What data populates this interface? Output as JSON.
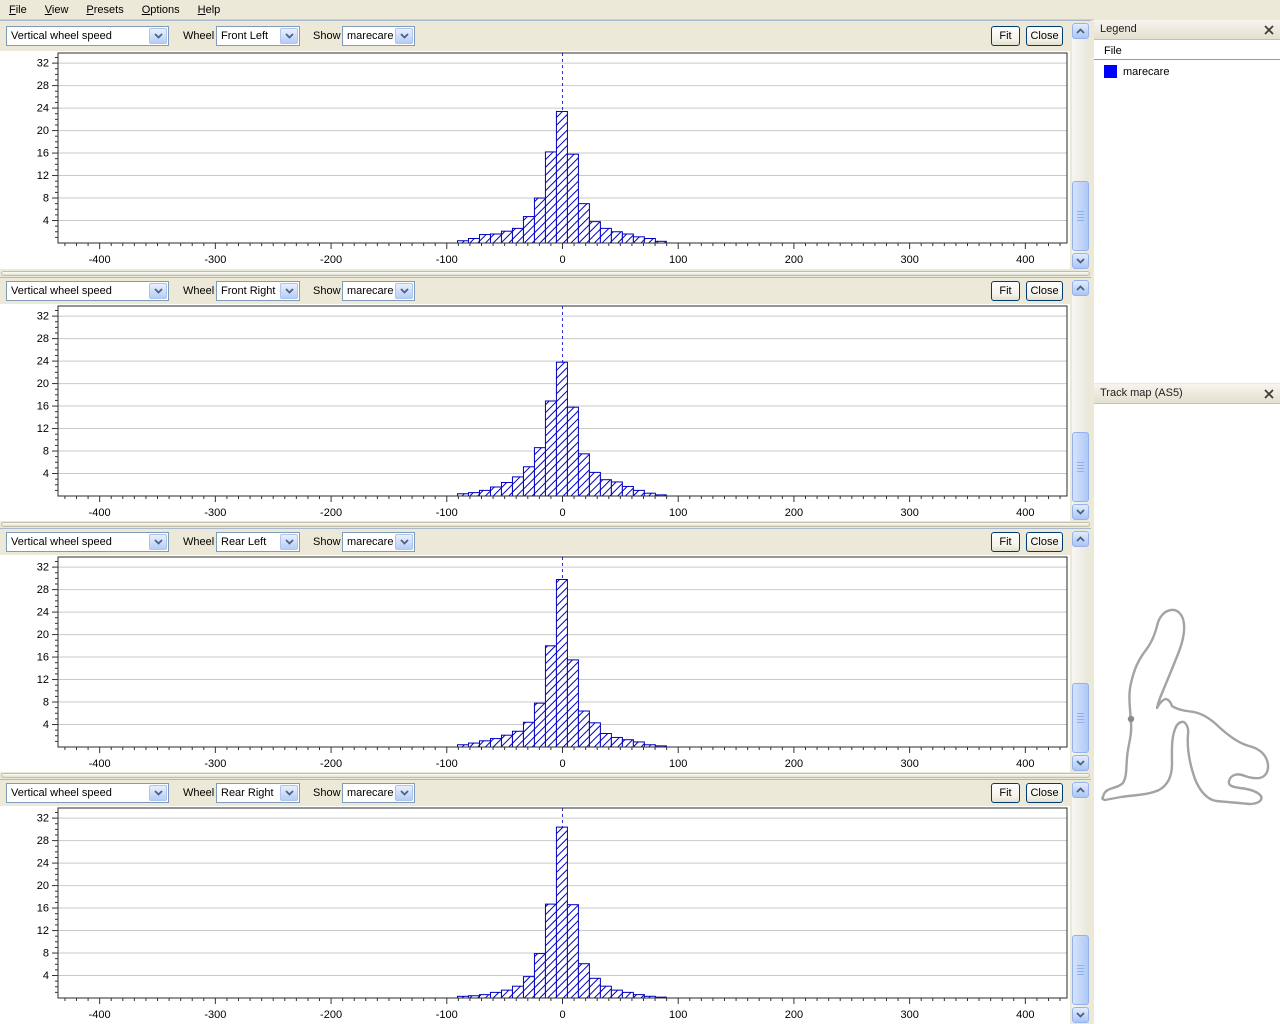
{
  "menu": {
    "items": [
      {
        "label": "File"
      },
      {
        "label": "View"
      },
      {
        "label": "Presets"
      },
      {
        "label": "Options"
      },
      {
        "label": "Help"
      }
    ]
  },
  "panels": [
    {
      "signal": "Vertical wheel speed",
      "wheel_label": "Wheel",
      "wheel": "Front Left",
      "show_label": "Show",
      "show": "marecare",
      "fit": "Fit",
      "close": "Close"
    },
    {
      "signal": "Vertical wheel speed",
      "wheel_label": "Wheel",
      "wheel": "Front Right",
      "show_label": "Show",
      "show": "marecare",
      "fit": "Fit",
      "close": "Close"
    },
    {
      "signal": "Vertical wheel speed",
      "wheel_label": "Wheel",
      "wheel": "Rear Left",
      "show_label": "Show",
      "show": "marecare",
      "fit": "Fit",
      "close": "Close"
    },
    {
      "signal": "Vertical wheel speed",
      "wheel_label": "Wheel",
      "wheel": "Rear Right",
      "show_label": "Show",
      "show": "marecare",
      "fit": "Fit",
      "close": "Close"
    }
  ],
  "chart_data": [
    {
      "type": "bar",
      "subtype": "histogram",
      "title": "Vertical wheel speed - Front Left",
      "series": "marecare",
      "bin_width": 9.5,
      "bin_centers": [
        -86,
        -76.5,
        -67,
        -57.5,
        -48,
        -38.5,
        -29,
        -19.5,
        -10,
        -0.5,
        9,
        18.5,
        28,
        37.5,
        47,
        56.5,
        66,
        75.5,
        85
      ],
      "values": [
        0.4,
        0.8,
        1.5,
        1.6,
        2.1,
        2.6,
        4.7,
        8.0,
        16.2,
        23.4,
        15.8,
        7.0,
        3.8,
        2.6,
        2.0,
        1.6,
        1.1,
        0.8,
        0.3
      ],
      "xlim": [
        -436,
        436
      ],
      "ylim": [
        0,
        33.8
      ],
      "x_ticks": [
        -400,
        -300,
        -200,
        -100,
        0,
        100,
        200,
        300,
        400
      ],
      "x_minor_step": 10,
      "y_ticks": [
        4,
        8,
        12,
        16,
        20,
        24,
        28,
        32
      ],
      "y_minor_step": 1,
      "zero_line_x": 0,
      "bar_color": "#0000c0",
      "grid_color": "#c9c9c9",
      "grid": "horizontal-only",
      "legend_position": "external-right"
    },
    {
      "type": "bar",
      "subtype": "histogram",
      "title": "Vertical wheel speed - Front Right",
      "series": "marecare",
      "bin_width": 9.5,
      "bin_centers": [
        -86,
        -76.5,
        -67,
        -57.5,
        -48,
        -38.5,
        -29,
        -19.5,
        -10,
        -0.5,
        9,
        18.5,
        28,
        37.5,
        47,
        56.5,
        66,
        75.5,
        85
      ],
      "values": [
        0.4,
        0.6,
        1.0,
        1.6,
        2.4,
        3.4,
        5.2,
        8.6,
        16.9,
        23.8,
        15.8,
        7.5,
        4.2,
        2.9,
        2.5,
        1.7,
        1.0,
        0.5,
        0.2
      ],
      "xlim": [
        -436,
        436
      ],
      "ylim": [
        0,
        33.8
      ],
      "x_ticks": [
        -400,
        -300,
        -200,
        -100,
        0,
        100,
        200,
        300,
        400
      ],
      "x_minor_step": 10,
      "y_ticks": [
        4,
        8,
        12,
        16,
        20,
        24,
        28,
        32
      ],
      "y_minor_step": 1,
      "zero_line_x": 0,
      "bar_color": "#0000c0",
      "grid_color": "#c9c9c9",
      "grid": "horizontal-only",
      "legend_position": "external-right"
    },
    {
      "type": "bar",
      "subtype": "histogram",
      "title": "Vertical wheel speed - Rear Left",
      "series": "marecare",
      "bin_width": 9.5,
      "bin_centers": [
        -86,
        -76.5,
        -67,
        -57.5,
        -48,
        -38.5,
        -29,
        -19.5,
        -10,
        -0.5,
        9,
        18.5,
        28,
        37.5,
        47,
        56.5,
        66,
        75.5,
        85
      ],
      "values": [
        0.4,
        0.7,
        1.1,
        1.5,
        2.1,
        2.8,
        4.4,
        7.8,
        18.0,
        29.8,
        15.5,
        6.4,
        4.3,
        2.4,
        1.7,
        1.3,
        0.9,
        0.4,
        0.2
      ],
      "xlim": [
        -436,
        436
      ],
      "ylim": [
        0,
        33.8
      ],
      "x_ticks": [
        -400,
        -300,
        -200,
        -100,
        0,
        100,
        200,
        300,
        400
      ],
      "x_minor_step": 10,
      "y_ticks": [
        4,
        8,
        12,
        16,
        20,
        24,
        28,
        32
      ],
      "y_minor_step": 1,
      "zero_line_x": 0,
      "bar_color": "#0000c0",
      "grid_color": "#c9c9c9",
      "grid": "horizontal-only",
      "legend_position": "external-right"
    },
    {
      "type": "bar",
      "subtype": "histogram",
      "title": "Vertical wheel speed - Rear Right",
      "series": "marecare",
      "bin_width": 9.5,
      "bin_centers": [
        -86,
        -76.5,
        -67,
        -57.5,
        -48,
        -38.5,
        -29,
        -19.5,
        -10,
        -0.5,
        9,
        18.5,
        28,
        37.5,
        47,
        56.5,
        66,
        75.5,
        85
      ],
      "values": [
        0.3,
        0.4,
        0.6,
        1.0,
        1.4,
        2.1,
        3.8,
        7.9,
        16.7,
        30.4,
        16.6,
        6.1,
        3.5,
        2.1,
        1.4,
        1.0,
        0.6,
        0.3,
        0.15
      ],
      "xlim": [
        -436,
        436
      ],
      "ylim": [
        0,
        33.8
      ],
      "x_ticks": [
        -400,
        -300,
        -200,
        -100,
        0,
        100,
        200,
        300,
        400
      ],
      "x_minor_step": 10,
      "y_ticks": [
        4,
        8,
        12,
        16,
        20,
        24,
        28,
        32
      ],
      "y_minor_step": 1,
      "zero_line_x": 0,
      "bar_color": "#0000c0",
      "grid_color": "#c9c9c9",
      "grid": "horizontal-only",
      "legend_position": "external-right"
    }
  ],
  "legend": {
    "title": "Legend",
    "column_header": "File",
    "items": [
      {
        "label": "marecare",
        "color": "#0000ff"
      }
    ]
  },
  "trackmap": {
    "title": "Track map (AS5)",
    "track_color": "#a3a3a3",
    "marker_color": "#8a8a8a"
  }
}
